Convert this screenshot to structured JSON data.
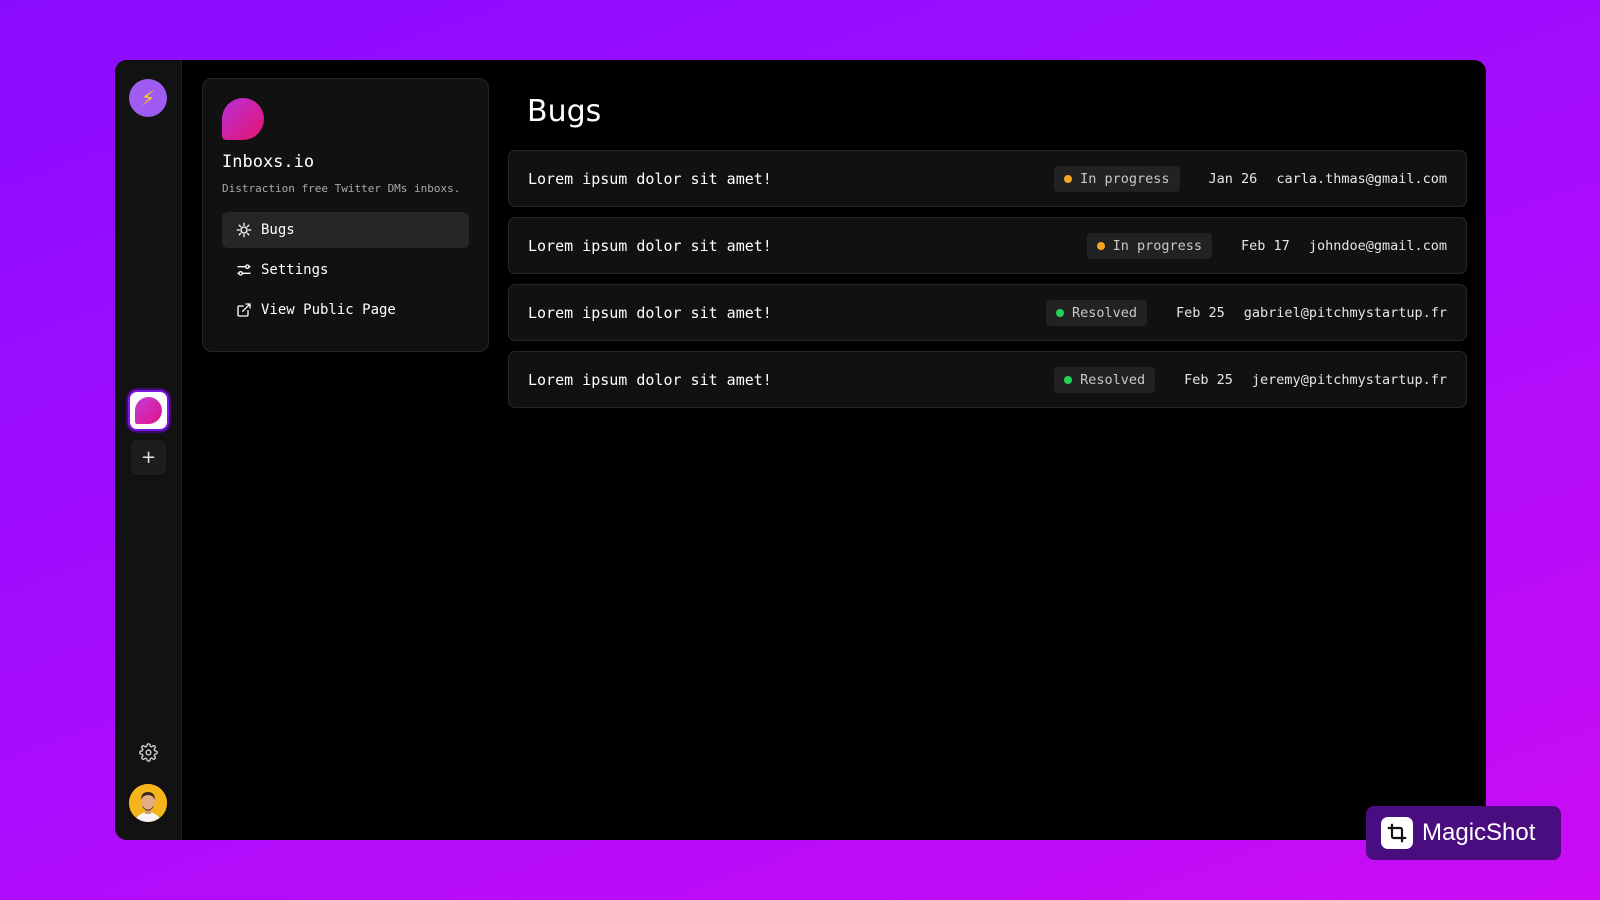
{
  "rail": {
    "logo_glyph": "⚡",
    "add_glyph": "+"
  },
  "project": {
    "name": "Inboxs.io",
    "description": "Distraction free Twitter DMs inboxs."
  },
  "nav": [
    {
      "label": "Bugs",
      "icon": "bug-icon",
      "active": true
    },
    {
      "label": "Settings",
      "icon": "sliders-icon",
      "active": false
    },
    {
      "label": "View Public Page",
      "icon": "external-link-icon",
      "active": false
    }
  ],
  "main": {
    "title": "Bugs"
  },
  "bugs": [
    {
      "title": "Lorem ipsum dolor sit amet!",
      "status": "In progress",
      "status_color": "#f5a524",
      "date": "Jan 26",
      "email": "carla.thmas@gmail.com"
    },
    {
      "title": "Lorem ipsum dolor sit amet!",
      "status": "In progress",
      "status_color": "#f5a524",
      "date": "Feb 17",
      "email": "johndoe@gmail.com"
    },
    {
      "title": "Lorem ipsum dolor sit amet!",
      "status": "Resolved",
      "status_color": "#22d35a",
      "date": "Feb 25",
      "email": "gabriel@pitchmystartup.fr"
    },
    {
      "title": "Lorem ipsum dolor sit amet!",
      "status": "Resolved",
      "status_color": "#22d35a",
      "date": "Feb 25",
      "email": "jeremy@pitchmystartup.fr"
    }
  ],
  "watermark": {
    "label": "MagicShot"
  }
}
